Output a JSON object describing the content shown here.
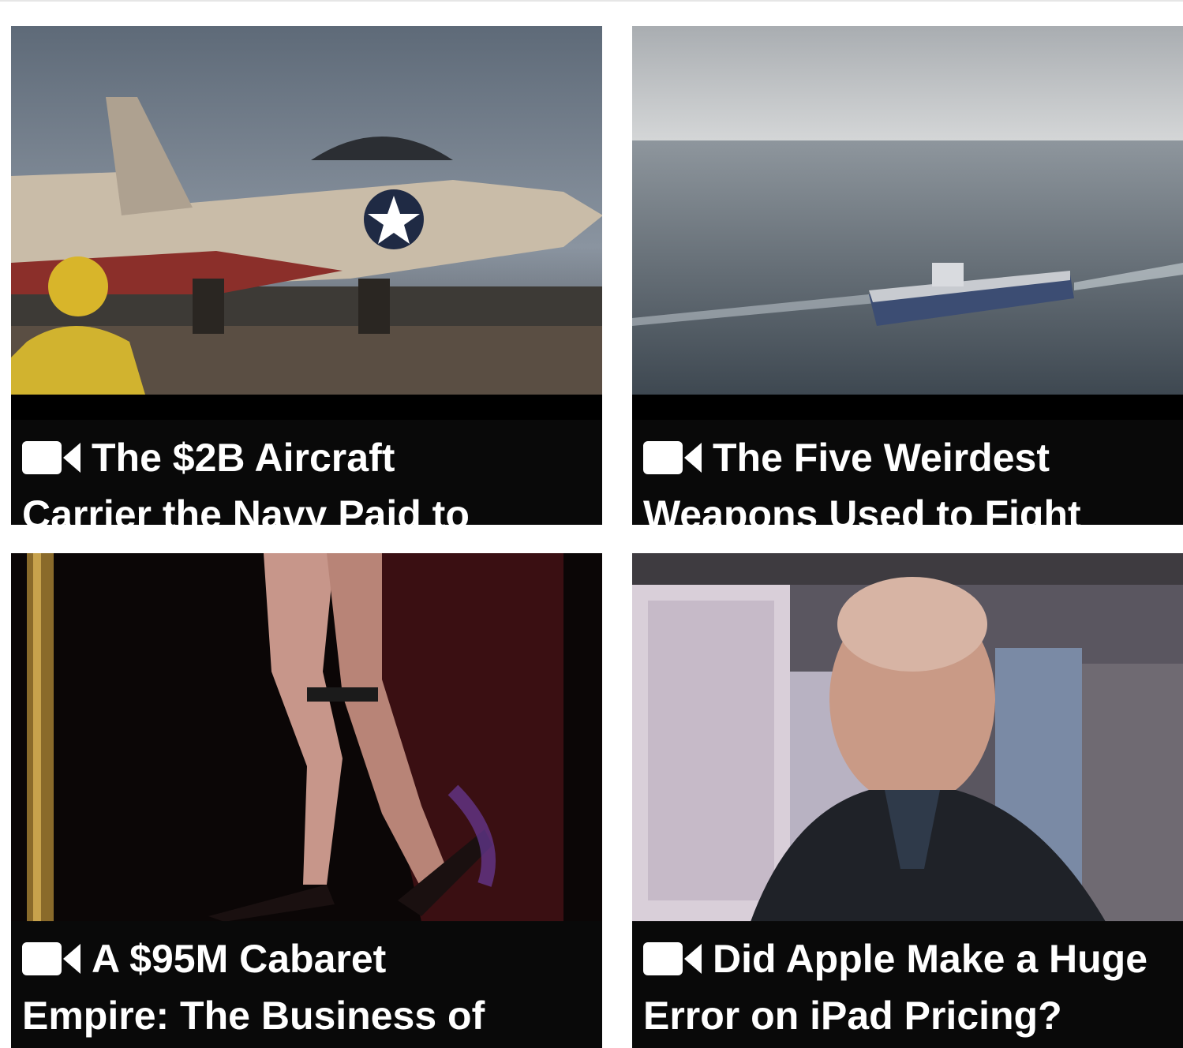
{
  "cards": [
    {
      "line1": "The $2B Aircraft",
      "line2": "Carrier the Navy Paid to",
      "thumb_icon": "fighter-jet-on-carrier-image"
    },
    {
      "line1": "The Five Weirdest",
      "line2": "Weapons Used to Fight",
      "thumb_icon": "aircraft-carrier-at-sea-image"
    },
    {
      "line1": "A $95M Cabaret",
      "line2": "Empire: The Business of",
      "thumb_icon": "dancer-legs-stage-image"
    },
    {
      "line1": "Did Apple Make a Huge",
      "line2": "Error on iPad Pricing?",
      "thumb_icon": "commentator-city-background-image"
    }
  ],
  "icons": {
    "video": "video-camera-icon"
  },
  "colors": {
    "caption_bg": "#0a0a0a",
    "caption_text": "#ffffff"
  }
}
